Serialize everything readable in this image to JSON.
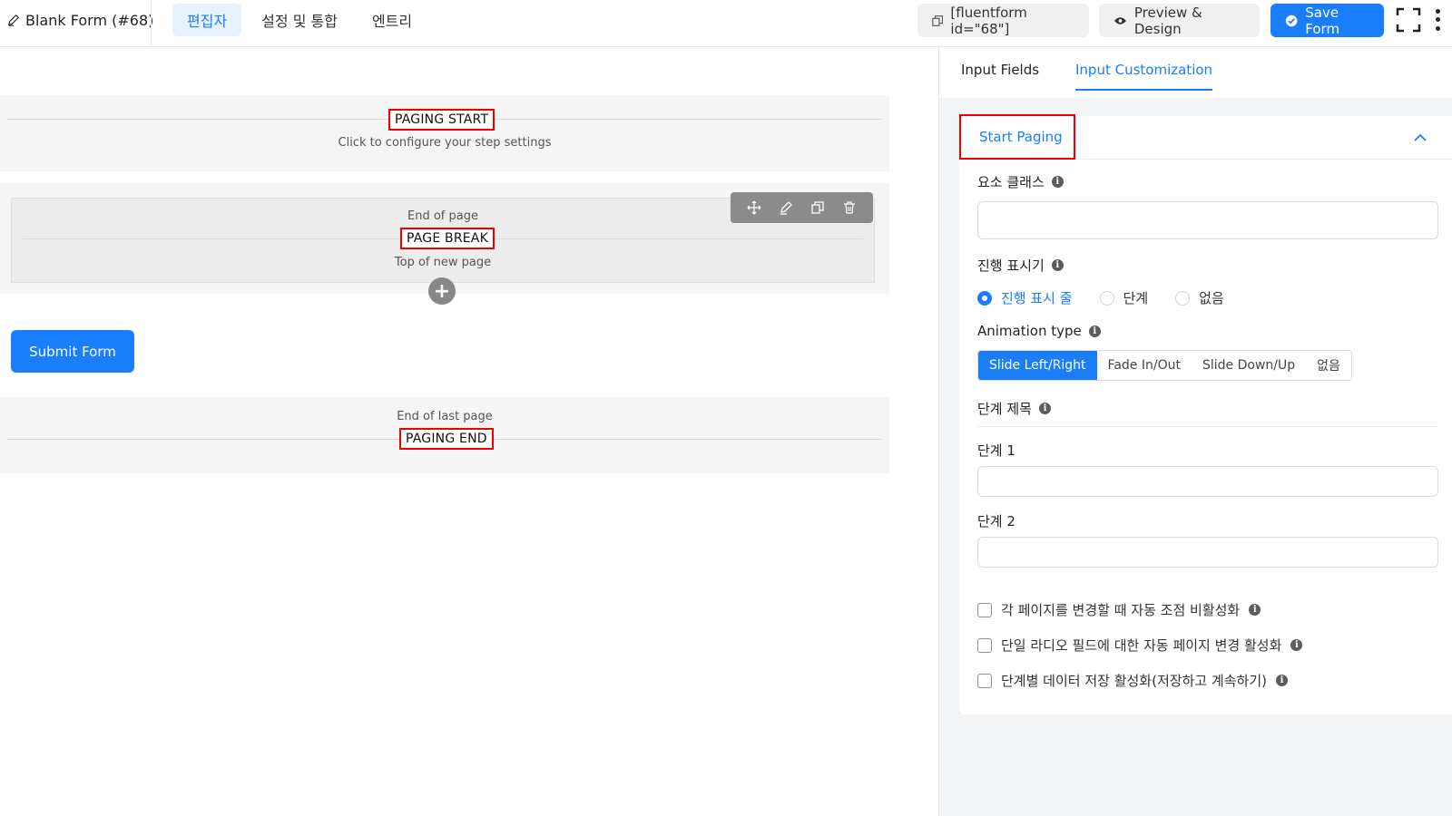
{
  "header": {
    "form_title": "Blank Form (#68)",
    "nav_tabs": [
      {
        "label": "편집자",
        "active": true
      },
      {
        "label": "설정 및 통합",
        "active": false
      },
      {
        "label": "엔트리",
        "active": false
      }
    ],
    "shortcode_label": "[fluentform id=\"68\"]",
    "preview_label": "Preview & Design",
    "save_label": "Save Form"
  },
  "canvas": {
    "paging_start": {
      "label": "PAGING START",
      "hint": "Click to configure your step settings"
    },
    "page_break": {
      "top_text": "End of page",
      "label": "PAGE BREAK",
      "bottom_text": "Top of new page"
    },
    "submit_label": "Submit Form",
    "paging_end": {
      "top_text": "End of last page",
      "label": "PAGING END"
    }
  },
  "sidebar": {
    "tabs": [
      {
        "label": "Input Fields",
        "active": false
      },
      {
        "label": "Input Customization",
        "active": true
      }
    ],
    "panel": {
      "title": "Start Paging",
      "element_class_label": "요소 클래스",
      "element_class_value": "",
      "progress_indicator_label": "진행 표시기",
      "progress_options": [
        {
          "label": "진행 표시 줄",
          "checked": true
        },
        {
          "label": "단계",
          "checked": false
        },
        {
          "label": "없음",
          "checked": false
        }
      ],
      "animation_label": "Animation type",
      "animation_options": [
        {
          "label": "Slide Left/Right",
          "active": true
        },
        {
          "label": "Fade In/Out",
          "active": false
        },
        {
          "label": "Slide Down/Up",
          "active": false
        },
        {
          "label": "없음",
          "active": false
        }
      ],
      "step_titles_label": "단계 제목",
      "step1_label": "단계 1",
      "step1_value": "",
      "step2_label": "단계 2",
      "step2_value": "",
      "checkboxes": [
        {
          "label": "각 페이지를 변경할 때 자동 조점 비활성화",
          "checked": false
        },
        {
          "label": "단일 라디오 필드에 대한 자동 페이지 변경 활성화",
          "checked": false
        },
        {
          "label": "단계별 데이터 저장 활성화(저장하고 계속하기)",
          "checked": false
        }
      ]
    }
  },
  "colors": {
    "accent": "#1a7efb",
    "highlight_border": "#ee0000"
  }
}
